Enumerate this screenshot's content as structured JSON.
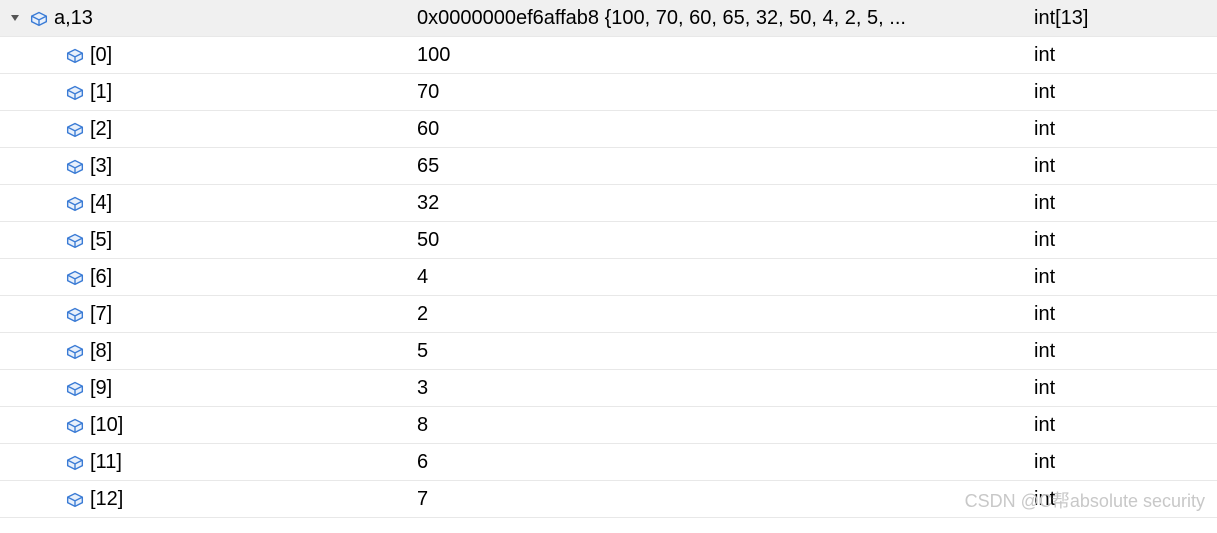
{
  "root": {
    "name": "a,13",
    "value": "0x0000000ef6affab8 {100, 70, 60, 65, 32, 50, 4, 2, 5, ...",
    "type": "int[13]"
  },
  "items": [
    {
      "name": "[0]",
      "value": "100",
      "type": "int"
    },
    {
      "name": "[1]",
      "value": "70",
      "type": "int"
    },
    {
      "name": "[2]",
      "value": "60",
      "type": "int"
    },
    {
      "name": "[3]",
      "value": "65",
      "type": "int"
    },
    {
      "name": "[4]",
      "value": "32",
      "type": "int"
    },
    {
      "name": "[5]",
      "value": "50",
      "type": "int"
    },
    {
      "name": "[6]",
      "value": "4",
      "type": "int"
    },
    {
      "name": "[7]",
      "value": "2",
      "type": "int"
    },
    {
      "name": "[8]",
      "value": "5",
      "type": "int"
    },
    {
      "name": "[9]",
      "value": "3",
      "type": "int"
    },
    {
      "name": "[10]",
      "value": "8",
      "type": "int"
    },
    {
      "name": "[11]",
      "value": "6",
      "type": "int"
    },
    {
      "name": "[12]",
      "value": "7",
      "type": "int"
    }
  ],
  "watermark": "CSDN @C帮absolute security"
}
